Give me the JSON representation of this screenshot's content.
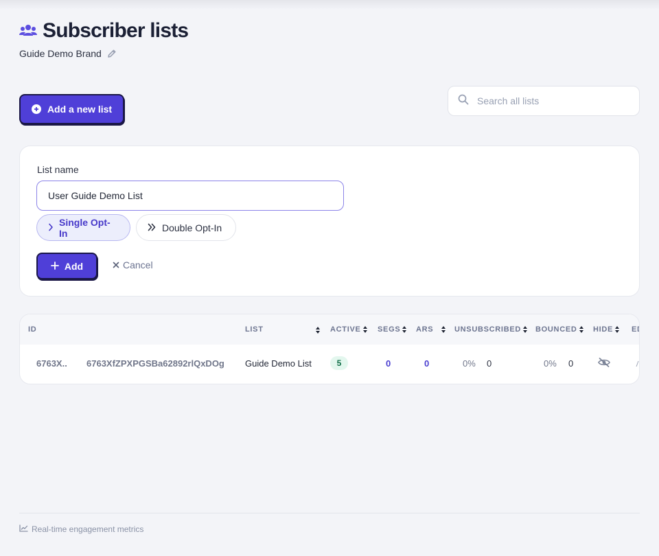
{
  "header": {
    "title": "Subscriber lists",
    "brand": "Guide Demo Brand"
  },
  "toolbar": {
    "add_list_label": "Add a new list",
    "search_placeholder": "Search all lists",
    "search_value": ""
  },
  "form": {
    "field_label": "List name",
    "name_value": "User Guide Demo List",
    "optin_single": "Single Opt-In",
    "optin_double": "Double Opt-In",
    "selected_optin": "Single Opt-In",
    "add_label": "Add",
    "cancel_label": "Cancel"
  },
  "table": {
    "columns": {
      "id": "ID",
      "list": "LIST",
      "active": "ACTIVE",
      "segs": "SEGS",
      "ars": "ARS",
      "unsubscribed": "UNSUBSCRIBED",
      "bounced": "BOUNCED",
      "hide": "HIDE",
      "edit": "ED"
    },
    "rows": [
      {
        "id_short": "6763X..",
        "id_full": "6763XfZPXPGSBa62892rlQxDOg",
        "list": "Guide Demo List",
        "active": "5",
        "segs": "0",
        "ars": "0",
        "unsub_pct": "0%",
        "unsub_count": "0",
        "bounced_pct": "0%",
        "bounced_count": "0"
      }
    ]
  },
  "footer": {
    "note": "Real-time engagement metrics"
  },
  "colors": {
    "accent": "#4f3fd8",
    "background": "#f3f4f8",
    "active_badge": "#e3f7ee"
  },
  "icons": [
    "users-icon",
    "pencil-icon",
    "plus-circle-icon",
    "search-icon",
    "chevron-right-icon",
    "double-chevron-right-icon",
    "plus-icon",
    "close-icon",
    "sort-icon",
    "eye-off-icon",
    "chart-line-icon"
  ]
}
